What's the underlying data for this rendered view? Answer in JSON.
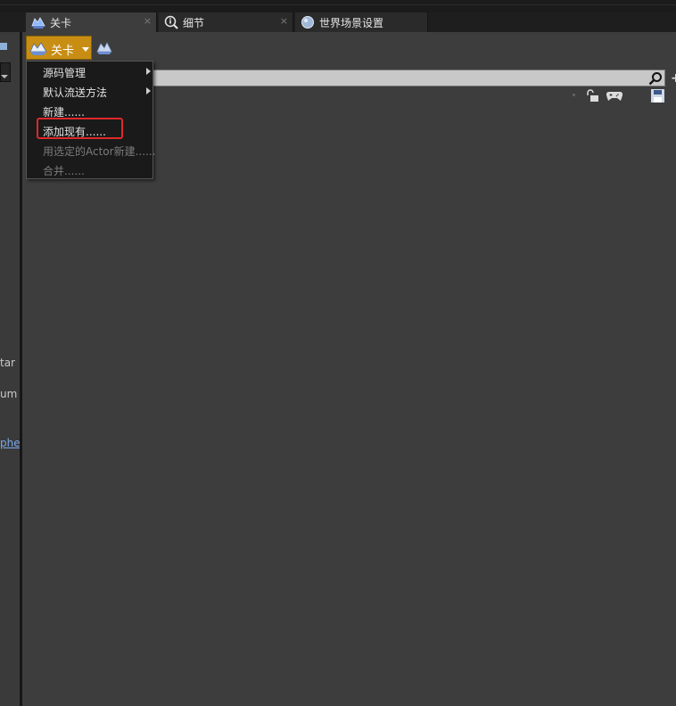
{
  "tabs": [
    {
      "label": "关卡",
      "icon": "levels-icon",
      "active": true
    },
    {
      "label": "细节",
      "icon": "details-icon",
      "active": false
    },
    {
      "label": "世界场景设置",
      "icon": "world-settings-icon",
      "active": false
    }
  ],
  "tab_close_glyph": "×",
  "toolbar": {
    "levels_button_label": "关卡"
  },
  "search": {
    "placeholder": "",
    "value": ""
  },
  "left_fragments": [
    "tar",
    "um",
    "phe"
  ],
  "edge_plus": "+",
  "menu": {
    "items": [
      {
        "label": "源码管理",
        "submenu": true,
        "enabled": true
      },
      {
        "label": "默认流送方法",
        "submenu": true,
        "enabled": true
      },
      {
        "label": "新建......",
        "submenu": false,
        "enabled": true
      },
      {
        "label": "添加现有......",
        "submenu": false,
        "enabled": true,
        "highlighted": true
      },
      {
        "label": "用选定的Actor新建......",
        "submenu": false,
        "enabled": false
      },
      {
        "label": "合并......",
        "submenu": false,
        "enabled": false
      }
    ]
  },
  "colors": {
    "background": "#3d3d3d",
    "accent_button": "#c88e14",
    "highlight_box": "#e0282a",
    "menu_bg": "#1a1a1a"
  }
}
